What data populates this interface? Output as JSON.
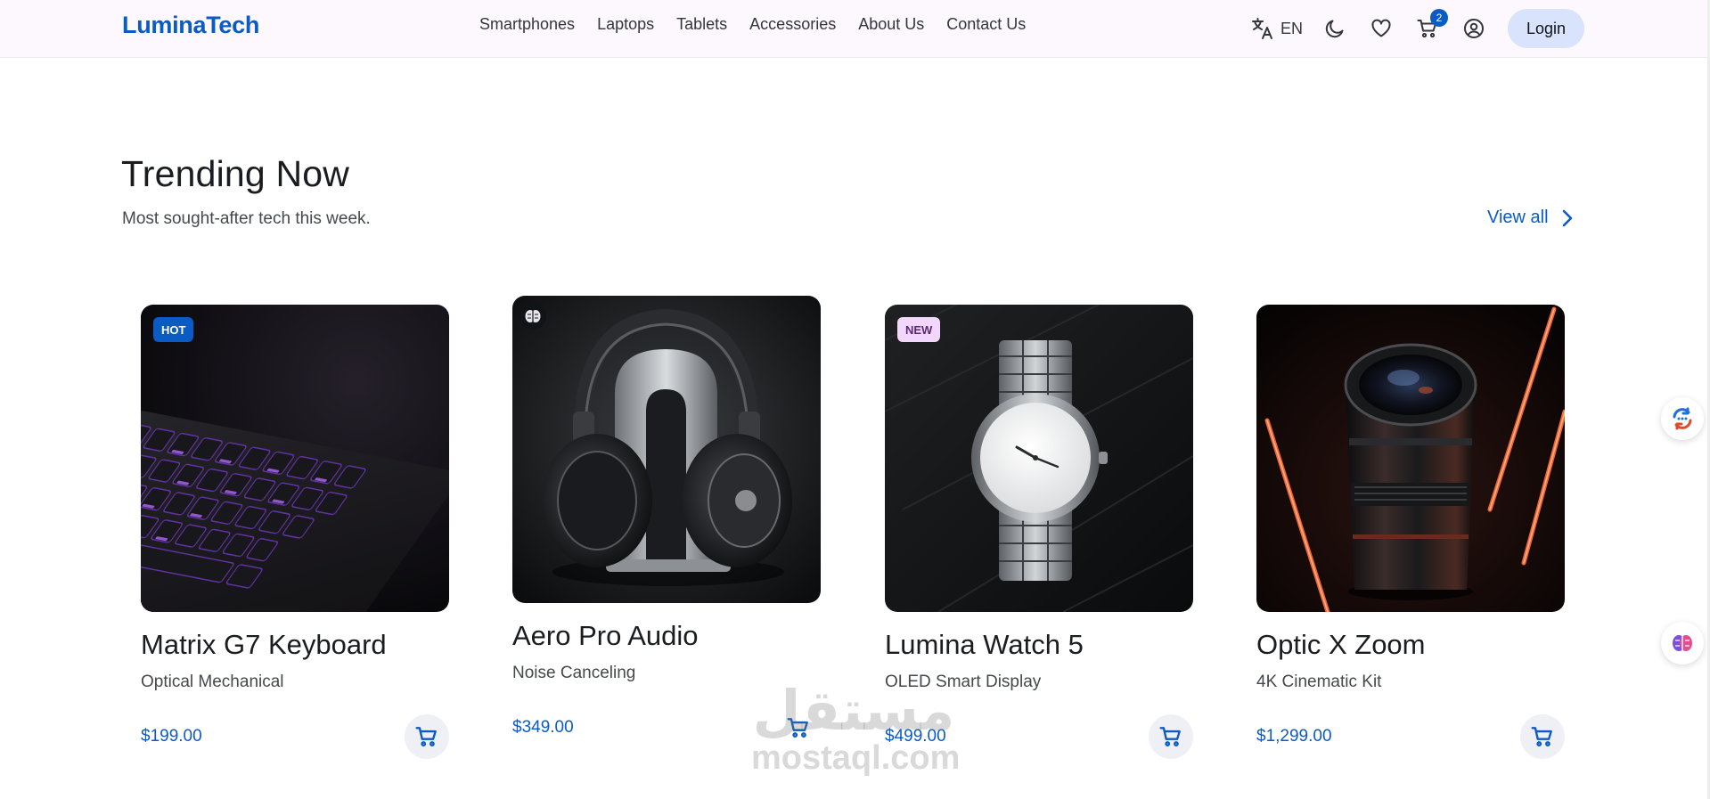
{
  "brand": {
    "logo": "LuminaTech",
    "accent": "#0b5bc4"
  },
  "nav": {
    "items": [
      "Smartphones",
      "Laptops",
      "Tablets",
      "Accessories",
      "About Us",
      "Contact Us"
    ]
  },
  "toolbar": {
    "language": "EN",
    "cart_count": "2",
    "login_label": "Login",
    "icons": [
      "translate-icon",
      "moon-icon",
      "heart-icon",
      "cart-icon",
      "account-icon"
    ]
  },
  "section": {
    "title": "Trending Now",
    "subtitle": "Most sought-after tech this week.",
    "view_all": "View all"
  },
  "products": [
    {
      "name": "Matrix G7 Keyboard",
      "subtitle": "Optical Mechanical",
      "price": "$199.00",
      "badge": "HOT"
    },
    {
      "name": "Aero Pro Audio",
      "subtitle": "Noise Canceling",
      "price": "$349.00",
      "badge_icon": "brain-icon"
    },
    {
      "name": "Lumina Watch 5",
      "subtitle": "OLED Smart Display",
      "price": "$499.00",
      "badge": "NEW"
    },
    {
      "name": "Optic X Zoom",
      "subtitle": "4K Cinematic Kit",
      "price": "$1,299.00"
    }
  ],
  "watermark": {
    "line1": "مستقل",
    "line2": "mostaql.com"
  }
}
